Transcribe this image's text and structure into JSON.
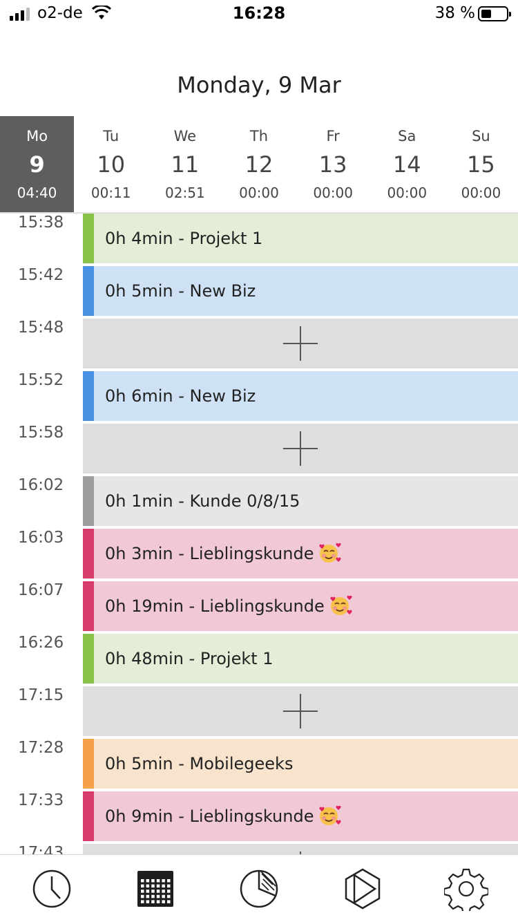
{
  "status_bar": {
    "carrier": "o2-de",
    "time": "16:28",
    "battery": "38 %",
    "battery_level": 0.38
  },
  "header": {
    "title": "Monday, 9 Mar"
  },
  "week": [
    {
      "name": "Mo",
      "date": "9",
      "total": "04:40",
      "selected": true
    },
    {
      "name": "Tu",
      "date": "10",
      "total": "00:11"
    },
    {
      "name": "We",
      "date": "11",
      "total": "02:51"
    },
    {
      "name": "Th",
      "date": "12",
      "total": "00:00"
    },
    {
      "name": "Fr",
      "date": "13",
      "total": "00:00"
    },
    {
      "name": "Sa",
      "date": "14",
      "total": "00:00"
    },
    {
      "name": "Su",
      "date": "15",
      "total": "00:00"
    }
  ],
  "entries": [
    {
      "time": "15:38",
      "type": "entry",
      "label": "0h 4min - Projekt 1",
      "color": "#8bc34a",
      "bg": "#e4edd8"
    },
    {
      "time": "15:42",
      "type": "entry",
      "label": "0h 5min - New Biz",
      "color": "#4a90e2",
      "bg": "#cfe1f5"
    },
    {
      "time": "15:48",
      "type": "gap"
    },
    {
      "time": "15:52",
      "type": "entry",
      "label": "0h 6min - New Biz",
      "color": "#4a90e2",
      "bg": "#cfe1f5"
    },
    {
      "time": "15:58",
      "type": "gap"
    },
    {
      "time": "16:02",
      "type": "entry",
      "label": "0h 1min - Kunde 0/8/15",
      "color": "#9e9e9e",
      "bg": "#e6e6e6"
    },
    {
      "time": "16:03",
      "type": "entry",
      "label": "0h 3min - Lieblingskunde",
      "emoji": "smiling-face-with-hearts",
      "color": "#d63d6a",
      "bg": "#f0c8d6"
    },
    {
      "time": "16:07",
      "type": "entry",
      "label": "0h 19min - Lieblingskunde",
      "emoji": "smiling-face-with-hearts",
      "color": "#d63d6a",
      "bg": "#f0c8d6"
    },
    {
      "time": "16:26",
      "type": "entry",
      "label": "0h 48min - Projekt 1",
      "color": "#8bc34a",
      "bg": "#e4edd8"
    },
    {
      "time": "17:15",
      "type": "gap"
    },
    {
      "time": "17:28",
      "type": "entry",
      "label": "0h 5min - Mobilegeeks",
      "color": "#f5a04a",
      "bg": "#f8e3cc"
    },
    {
      "time": "17:33",
      "type": "entry",
      "label": "0h 9min - Lieblingskunde",
      "emoji": "smiling-face-with-hearts",
      "color": "#d63d6a",
      "bg": "#f0c8d6"
    },
    {
      "time": "17:43",
      "type": "gap"
    }
  ],
  "tabs": [
    {
      "icon": "clock-icon"
    },
    {
      "icon": "calendar-icon",
      "active": true
    },
    {
      "icon": "pie-chart-icon"
    },
    {
      "icon": "play-icon"
    },
    {
      "icon": "gear-icon"
    }
  ]
}
